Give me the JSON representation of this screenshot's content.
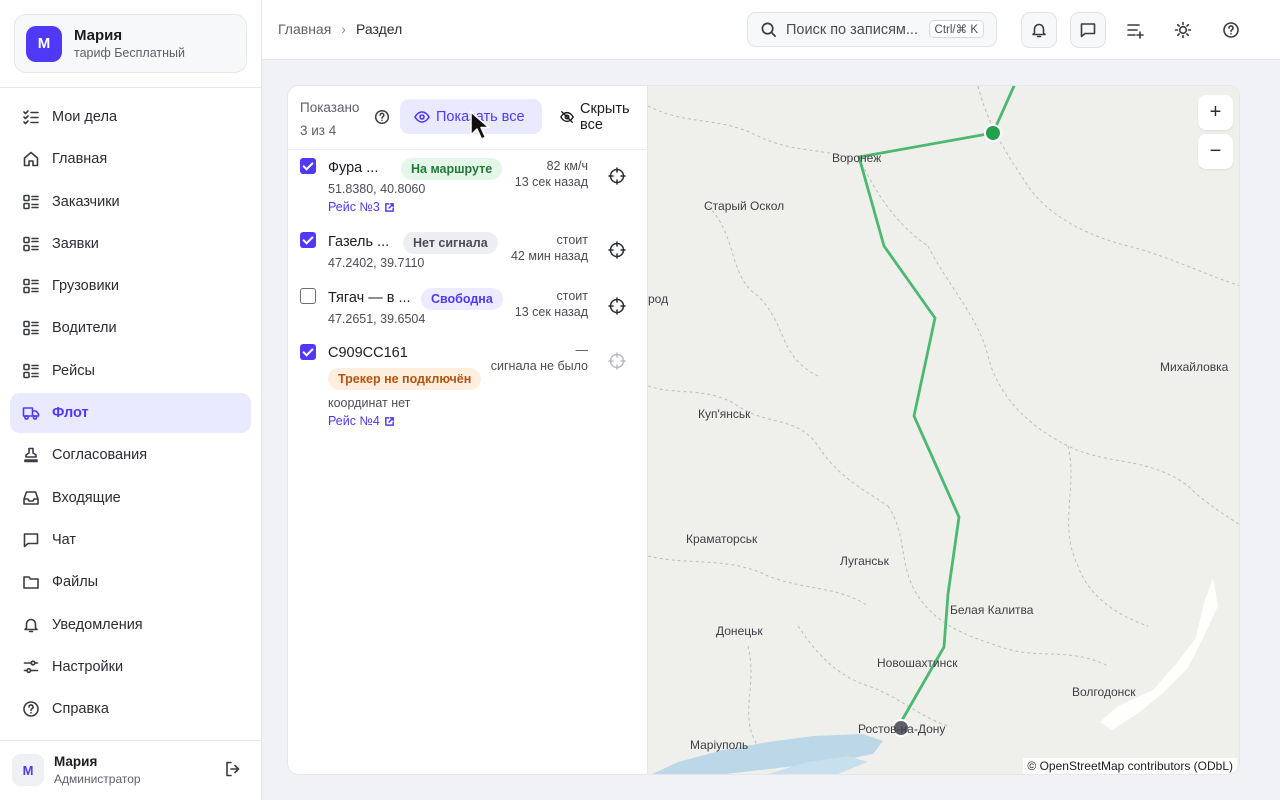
{
  "org": {
    "initial": "М",
    "name": "Мария",
    "plan": "тариф Бесплатный"
  },
  "nav": [
    {
      "label": "Мои дела",
      "icon": "checklist-icon"
    },
    {
      "label": "Главная",
      "icon": "home-icon"
    },
    {
      "label": "Заказчики",
      "icon": "list-icon"
    },
    {
      "label": "Заявки",
      "icon": "list-icon"
    },
    {
      "label": "Грузовики",
      "icon": "list-icon"
    },
    {
      "label": "Водители",
      "icon": "list-icon"
    },
    {
      "label": "Рейсы",
      "icon": "list-icon"
    },
    {
      "label": "Флот",
      "icon": "truck-icon",
      "active": true
    },
    {
      "label": "Согласования",
      "icon": "stamp-icon"
    },
    {
      "label": "Входящие",
      "icon": "inbox-icon"
    },
    {
      "label": "Чат",
      "icon": "chat-icon"
    },
    {
      "label": "Файлы",
      "icon": "folder-icon"
    },
    {
      "label": "Уведомления",
      "icon": "bell-icon"
    },
    {
      "label": "Настройки",
      "icon": "sliders-icon"
    },
    {
      "label": "Справка",
      "icon": "help-circle-icon"
    }
  ],
  "user": {
    "initial": "М",
    "name": "Мария",
    "role": "Администратор"
  },
  "breadcrumb": {
    "root": "Главная",
    "current": "Раздел"
  },
  "search": {
    "placeholder": "Поиск по записям...",
    "shortcut": "Ctrl/⌘ K"
  },
  "list": {
    "shown_label": "Показано",
    "shown_count": "3 из 4",
    "show_all": "Показать все",
    "hide_all": "Скрыть все",
    "vehicles": [
      {
        "name": "Фура ...",
        "status": "На маршруте",
        "status_color": "green",
        "coords": "51.8380, 40.8060",
        "meta1": "82 км/ч",
        "meta2": "13 сек назад",
        "trip": "Рейс №3",
        "checked": true
      },
      {
        "name": "Газель ...",
        "status": "Нет сигнала",
        "status_color": "gray",
        "coords": "47.2402, 39.7110",
        "meta1": "стоит",
        "meta2": "42 мин назад",
        "checked": true
      },
      {
        "name": "Тягач — в ...",
        "status": "Свободна",
        "status_color": "violet",
        "coords": "47.2651, 39.6504",
        "meta1": "стоит",
        "meta2": "13 сек назад",
        "checked": false
      },
      {
        "name": "С909СС161",
        "status": "Трекер не подключён",
        "status_color": "orange",
        "coords": "координат нет",
        "meta1": "—",
        "meta2": "сигнала не было",
        "trip": "Рейс №4",
        "checked": true
      }
    ]
  },
  "map": {
    "cities": [
      "Воронеж",
      "Старый Оскол",
      "род",
      "Михайловка",
      "Куп'янськ",
      "Краматорськ",
      "Луганськ",
      "Белая Калитва",
      "Донецьк",
      "Новошахтинск",
      "Волгодонск",
      "Ростов-на-Дону",
      "Маріуполь"
    ],
    "zoom_in": "+",
    "zoom_out": "−",
    "attribution": "© OpenStreetMap contributors (ODbL)",
    "route_color": "#4cb870",
    "marker_color": "#22a04b",
    "marker_gray": "#5d606b"
  },
  "colors": {
    "accent": "#4f39f6"
  }
}
